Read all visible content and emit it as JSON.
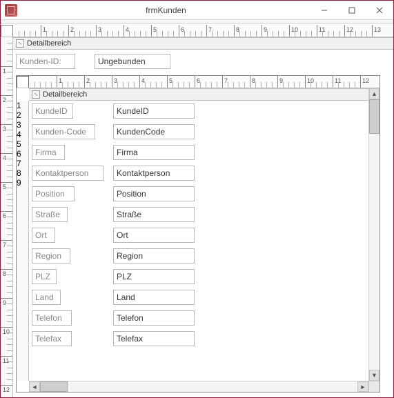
{
  "window": {
    "title": "frmKunden"
  },
  "outer": {
    "section_header": "Detailbereich",
    "kunden_id_label": "Kunden-ID:",
    "kunden_id_value": "Ungebunden"
  },
  "subform": {
    "section_header": "Detailbereich",
    "fields": [
      {
        "label": "KundeID",
        "value": "KundeID"
      },
      {
        "label": "Kunden-Code",
        "value": "KundenCode"
      },
      {
        "label": "Firma",
        "value": "Firma"
      },
      {
        "label": "Kontaktperson",
        "value": "Kontaktperson"
      },
      {
        "label": "Position",
        "value": "Position"
      },
      {
        "label": "Straße",
        "value": "Straße"
      },
      {
        "label": "Ort",
        "value": "Ort"
      },
      {
        "label": "Region",
        "value": "Region"
      },
      {
        "label": "PLZ",
        "value": "PLZ"
      },
      {
        "label": "Land",
        "value": "Land"
      },
      {
        "label": "Telefon",
        "value": "Telefon"
      },
      {
        "label": "Telefax",
        "value": "Telefax"
      }
    ],
    "label_widths": [
      60,
      92,
      48,
      104,
      62,
      52,
      34,
      56,
      36,
      42,
      58,
      58
    ]
  }
}
